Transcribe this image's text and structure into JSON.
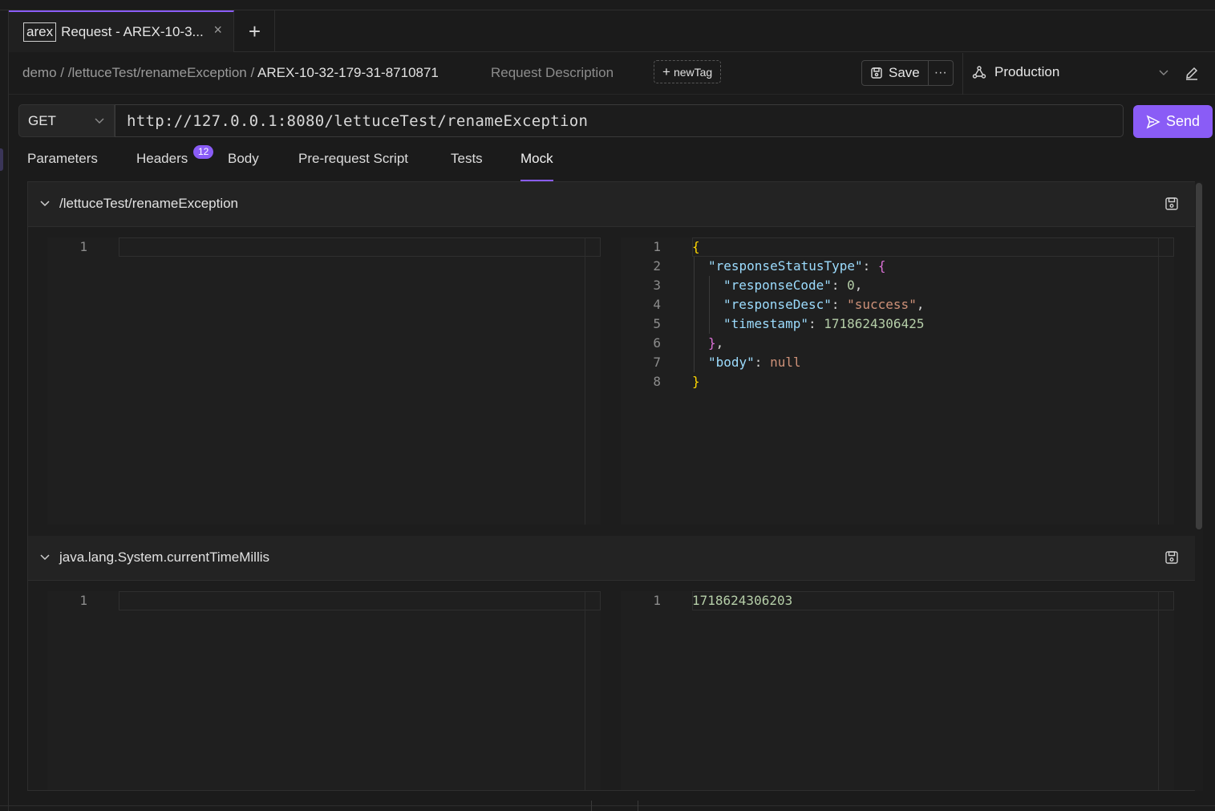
{
  "tab": {
    "tag": "arex",
    "title": "Request - AREX-10-3...",
    "close": "×",
    "add": "+"
  },
  "breadcrumb": {
    "part1": "demo",
    "sep": "/",
    "part2": "/lettuceTest/renameException",
    "part3": "AREX-10-32-179-31-8710871"
  },
  "request_description": "Request Description",
  "new_tag": {
    "plus": "+",
    "label": "newTag"
  },
  "save": {
    "label": "Save",
    "more": "···"
  },
  "environment": {
    "name": "Production"
  },
  "method": "GET",
  "url": "http://127.0.0.1:8080/lettuceTest/renameException",
  "send_label": "Send",
  "subtabs": [
    {
      "label": "Parameters"
    },
    {
      "label": "Headers",
      "badge": "12"
    },
    {
      "label": "Body"
    },
    {
      "label": "Pre-request Script"
    },
    {
      "label": "Tests"
    },
    {
      "label": "Mock"
    }
  ],
  "mocks": [
    {
      "title": "/lettuceTest/renameException",
      "left_lines": [
        "1"
      ],
      "right_lines": [
        "1",
        "2",
        "3",
        "4",
        "5",
        "6",
        "7",
        "8"
      ],
      "right_code": {
        "l1": "{",
        "l2_key": "\"responseStatusType\"",
        "l2_rest": ": ",
        "l2_brace": "{",
        "l3_key": "\"responseCode\"",
        "l3_rest": ": ",
        "l3_val": "0",
        "l3_end": ",",
        "l4_key": "\"responseDesc\"",
        "l4_rest": ": ",
        "l4_val": "\"success\"",
        "l4_end": ",",
        "l5_key": "\"timestamp\"",
        "l5_rest": ": ",
        "l5_val": "1718624306425",
        "l6": "}",
        "l6_end": ",",
        "l7_key": "\"body\"",
        "l7_rest": ": ",
        "l7_val": "null",
        "l8": "}"
      }
    },
    {
      "title": "java.lang.System.currentTimeMillis",
      "left_lines": [
        "1"
      ],
      "right_lines": [
        "1"
      ],
      "right_code": {
        "l1": "1718624306203"
      }
    }
  ]
}
